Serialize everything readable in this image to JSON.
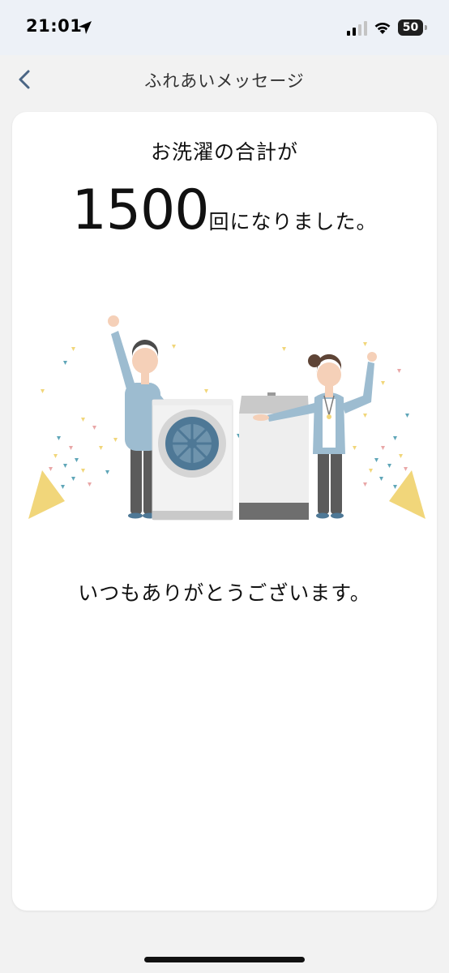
{
  "status_bar": {
    "time": "21:01",
    "battery_level": "50",
    "icons": [
      "location-arrow-icon",
      "signal-icon",
      "wifi-icon",
      "battery-icon"
    ]
  },
  "nav": {
    "title": "ふれあいメッセージ",
    "back_icon": "chevron-left-icon"
  },
  "message": {
    "headline": "お洗濯の合計が",
    "count": "1500",
    "count_suffix": "回になりました。",
    "thanks": "いつもありがとうございます。"
  },
  "colors": {
    "shirt_blue": "#9dbcd0",
    "pants_gray": "#5b5b5b",
    "confetti_yellow": "#f1d67a",
    "confetti_teal": "#5fa6b8",
    "confetti_pink": "#e9a7a7",
    "washer_drum": "#4e7896"
  }
}
